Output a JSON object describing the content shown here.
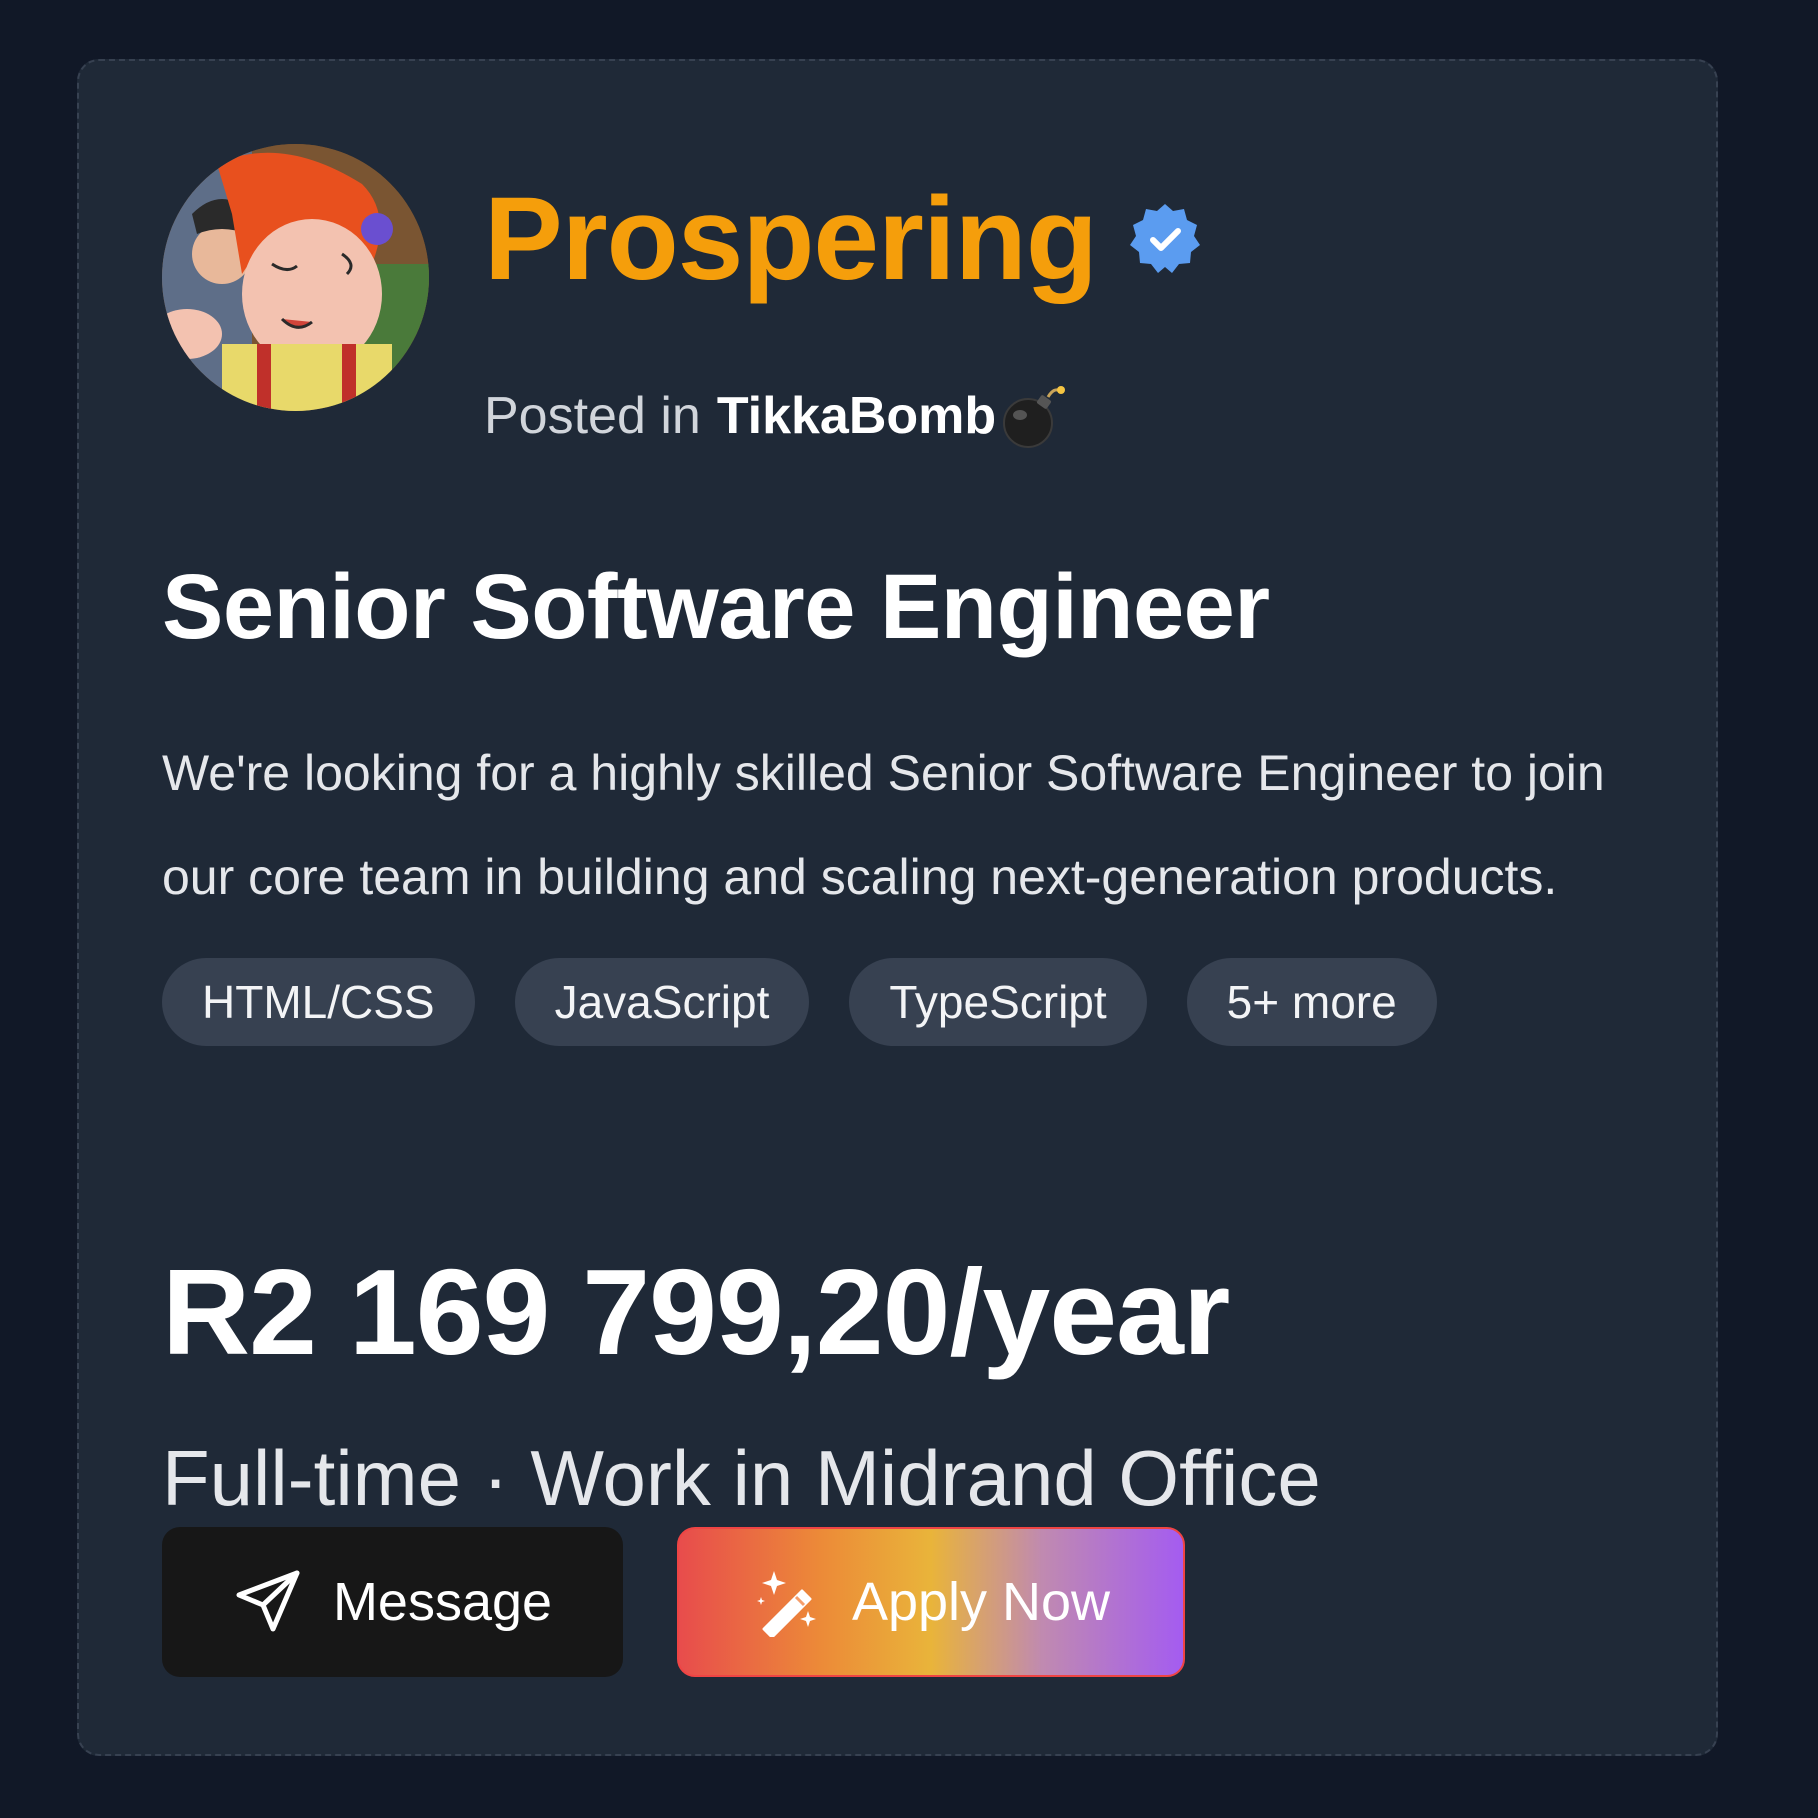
{
  "company": {
    "name": "Prospering",
    "verified_icon": "verified-badge-icon",
    "brand_color": "#f59e0b",
    "badge_color": "#5b9cf0"
  },
  "posted": {
    "prefix": "Posted in",
    "community": "TikkaBomb",
    "community_icon": "bomb-icon"
  },
  "job": {
    "title": "Senior Software Engineer",
    "description": "We're looking for a highly skilled Senior Software Engineer to join our core team in building and scaling next-generation products.",
    "tags": [
      "HTML/CSS",
      "JavaScript",
      "TypeScript",
      "5+ more"
    ],
    "salary": "R2 169 799,20/year",
    "employment": "Full-time · Work in Midrand Office"
  },
  "actions": {
    "message_label": "Message",
    "message_icon": "send-icon",
    "apply_label": "Apply Now",
    "apply_icon": "magic-wand-icon"
  },
  "colors": {
    "page_background": "#111827",
    "card_background": "#1f2937",
    "tag_background": "#374151",
    "message_button": "#171717"
  }
}
